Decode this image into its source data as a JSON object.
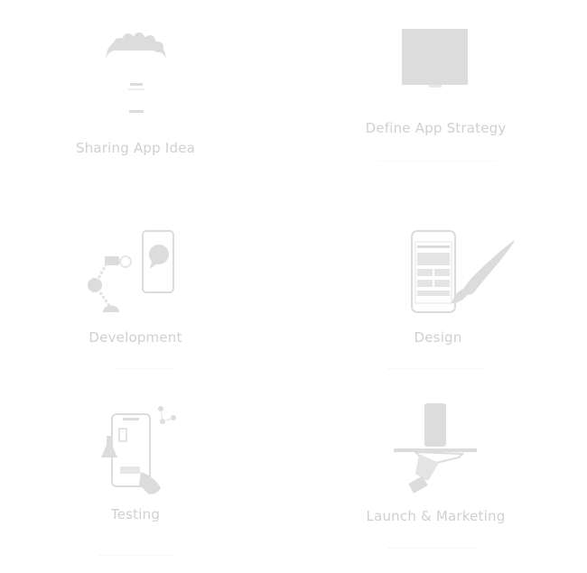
{
  "colors": {
    "icon": "#dcdcdc",
    "label": "#d0d0d0",
    "background": "#ffffff"
  },
  "steps": [
    {
      "id": "sharing",
      "label": "Sharing App Idea",
      "icon": "lightbulb-icon"
    },
    {
      "id": "strategy",
      "label": "Define App Strategy",
      "icon": "strategy-board-icon"
    },
    {
      "id": "development",
      "label": "Development",
      "icon": "robot-arm-phone-icon"
    },
    {
      "id": "design",
      "label": "Design",
      "icon": "phone-paintbrush-icon"
    },
    {
      "id": "testing",
      "label": "Testing",
      "icon": "phone-testing-icon"
    },
    {
      "id": "launch",
      "label": "Launch & Marketing",
      "icon": "phone-on-tray-icon"
    }
  ]
}
